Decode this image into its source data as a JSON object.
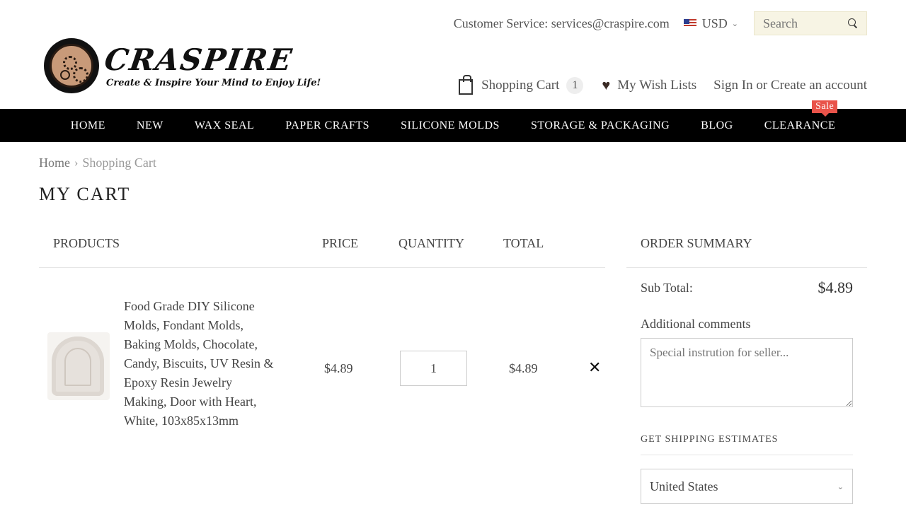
{
  "brand": {
    "name": "CRASPIRE",
    "tagline": "Create & Inspire Your Mind to Enjoy Life!"
  },
  "header": {
    "customer_service": "Customer Service: services@craspire.com",
    "currency": "USD",
    "search_placeholder": "Search",
    "cart_label": "Shopping Cart",
    "cart_count": "1",
    "wishlist_label": "My Wish Lists",
    "sign_in": "Sign In",
    "or": "or",
    "create_account": "Create an account"
  },
  "nav": {
    "items": [
      "HOME",
      "NEW",
      "WAX SEAL",
      "PAPER CRAFTS",
      "SILICONE MOLDS",
      "STORAGE & PACKAGING",
      "BLOG",
      "CLEARANCE"
    ],
    "sale_badge": "Sale"
  },
  "breadcrumb": {
    "home": "Home",
    "current": "Shopping Cart"
  },
  "page_title": "MY CART",
  "cart": {
    "columns": {
      "products": "PRODUCTS",
      "price": "PRICE",
      "quantity": "QUANTITY",
      "total": "TOTAL"
    },
    "items": [
      {
        "name": "Food Grade DIY Silicone Molds, Fondant Molds, Baking Molds, Chocolate, Candy, Biscuits, UV Resin & Epoxy Resin Jewelry Making, Door with Heart, White, 103x85x13mm",
        "price": "$4.89",
        "quantity": "1",
        "total": "$4.89",
        "remove_symbol": "✕"
      }
    ]
  },
  "summary": {
    "title": "ORDER SUMMARY",
    "subtotal_label": "Sub Total:",
    "subtotal_value": "$4.89",
    "comments_label": "Additional comments",
    "comments_placeholder": "Special instrution for seller...",
    "shipping_title": "GET SHIPPING ESTIMATES",
    "country": "United States"
  },
  "colors": {
    "nav_bg": "#000000",
    "sale_badge": "#e9534a",
    "search_bg": "#f7f4e4"
  }
}
